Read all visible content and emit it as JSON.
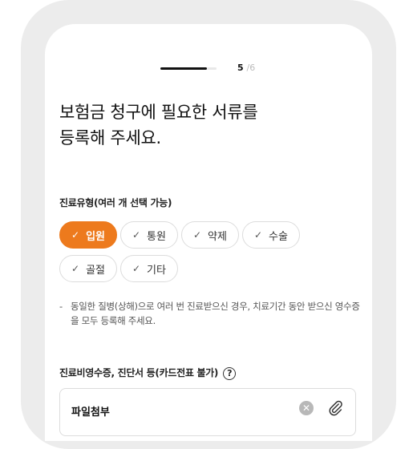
{
  "status": {
    "time_partial": "..."
  },
  "progress": {
    "current": "5",
    "separator": "/",
    "total": "6",
    "fraction": 0.83
  },
  "title": {
    "line1": "보험금 청구에 필요한 서류를",
    "line2": "등록해 주세요."
  },
  "treatment_type": {
    "label": "진료유형(여러 개 선택 가능)",
    "options": [
      {
        "label": "입원",
        "selected": true
      },
      {
        "label": "통원",
        "selected": false
      },
      {
        "label": "약제",
        "selected": false
      },
      {
        "label": "수술",
        "selected": false
      },
      {
        "label": "골절",
        "selected": false
      },
      {
        "label": "기타",
        "selected": false
      }
    ]
  },
  "note": {
    "dash": "-",
    "text": "동일한 질병(상해)으로 여러 번 진료받으신 경우, 치료기간 동안 받으신 영수증을 모두 등록해 주세요."
  },
  "documents": {
    "label": "진료비영수증, 진단서 등(카드전표 불가)",
    "help_icon": "question-circle-icon",
    "help_glyph": "?",
    "file_label": "파일첨부",
    "clear_glyph": "✕"
  },
  "colors": {
    "accent": "#ed7a1d",
    "frame": "#ececec"
  }
}
